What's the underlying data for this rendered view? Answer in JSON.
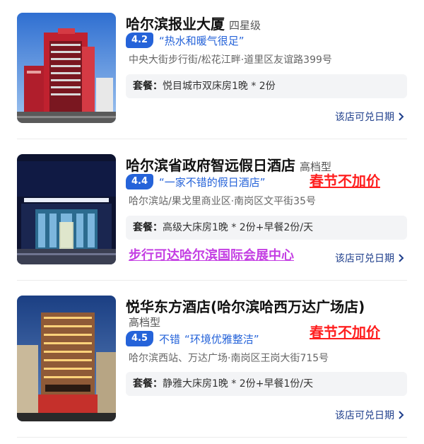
{
  "hotels": [
    {
      "name": "哈尔滨报业大厦",
      "grade": "四星级",
      "score": "4.2",
      "prefix": "",
      "quote": "“热水和暖气很足”",
      "address": "中央大街步行街/松花江畔·道里区友谊路399号",
      "package_label": "套餐：",
      "package": "悦目城市双床房1晚 * 2份",
      "link": "该店可兑日期"
    },
    {
      "name": "哈尔滨省政府智远假日酒店",
      "grade": "高档型",
      "score": "4.4",
      "prefix": "",
      "quote": "“一家不错的假日酒店”",
      "address": "哈尔滨站/果戈里商业区·南岗区文平街35号",
      "package_label": "套餐：",
      "package": "高级大床房1晚 * 2份+早餐2份/天",
      "link": "该店可兑日期",
      "promo": "春节不加价",
      "promo2": "步行可达哈尔滨国际会展中心"
    },
    {
      "name": "悦华东方酒店(哈尔滨哈西万达广场店)",
      "grade": "高档型",
      "score": "4.5",
      "prefix": "不错",
      "quote": "“环境优雅整洁”",
      "address": "哈尔滨西站、万达广场·南岗区王岗大街715号",
      "package_label": "套餐：",
      "package": "静雅大床房1晚 * 2份+早餐1份/天",
      "link": "该店可兑日期",
      "promo": "春节不加价"
    }
  ],
  "colors": {
    "accent": "#2563d9",
    "link": "#1f3f8c",
    "promo_red": "#ff2020",
    "promo_purple": "#c43fe3"
  }
}
